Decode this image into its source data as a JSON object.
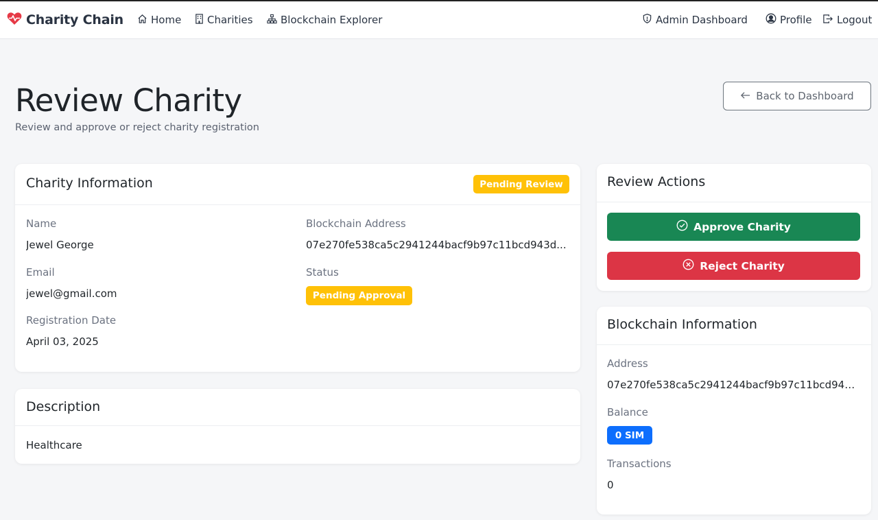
{
  "colors": {
    "brand_red": "#e63946",
    "warning": "#ffc107",
    "primary": "#0d6efd",
    "success": "#198754",
    "danger": "#dc3545"
  },
  "navbar": {
    "brand": "Charity Chain",
    "brand_icon": "heart-pulse-icon",
    "links": [
      {
        "label": "Home",
        "icon": "house-icon"
      },
      {
        "label": "Charities",
        "icon": "building-icon"
      },
      {
        "label": "Blockchain Explorer",
        "icon": "diagram-icon"
      }
    ],
    "right_links": [
      {
        "label": "Admin Dashboard",
        "icon": "shield-icon"
      },
      {
        "label": "Profile",
        "icon": "user-circle-icon"
      },
      {
        "label": "Logout",
        "icon": "logout-icon"
      }
    ]
  },
  "header": {
    "title": "Review Charity",
    "subtitle": "Review and approve or reject charity registration",
    "back_button": "Back to Dashboard"
  },
  "charity_info": {
    "title": "Charity Information",
    "badge": "Pending Review",
    "name_label": "Name",
    "name": "Jewel George",
    "email_label": "Email",
    "email": "jewel@gmail.com",
    "date_label": "Registration Date",
    "date": "April 03, 2025",
    "address_label": "Blockchain Address",
    "address": "07e270fe538ca5c2941244bacf9b97c11bcd943d...",
    "status_label": "Status",
    "status": "Pending Approval"
  },
  "description": {
    "title": "Description",
    "text": "Healthcare"
  },
  "review_actions": {
    "title": "Review Actions",
    "approve": "Approve Charity",
    "reject": "Reject Charity"
  },
  "blockchain_info": {
    "title": "Blockchain Information",
    "address_label": "Address",
    "address": "07e270fe538ca5c2941244bacf9b97c11bcd943...",
    "balance_label": "Balance",
    "balance": "0 SIM",
    "transactions_label": "Transactions",
    "transactions": "0"
  }
}
